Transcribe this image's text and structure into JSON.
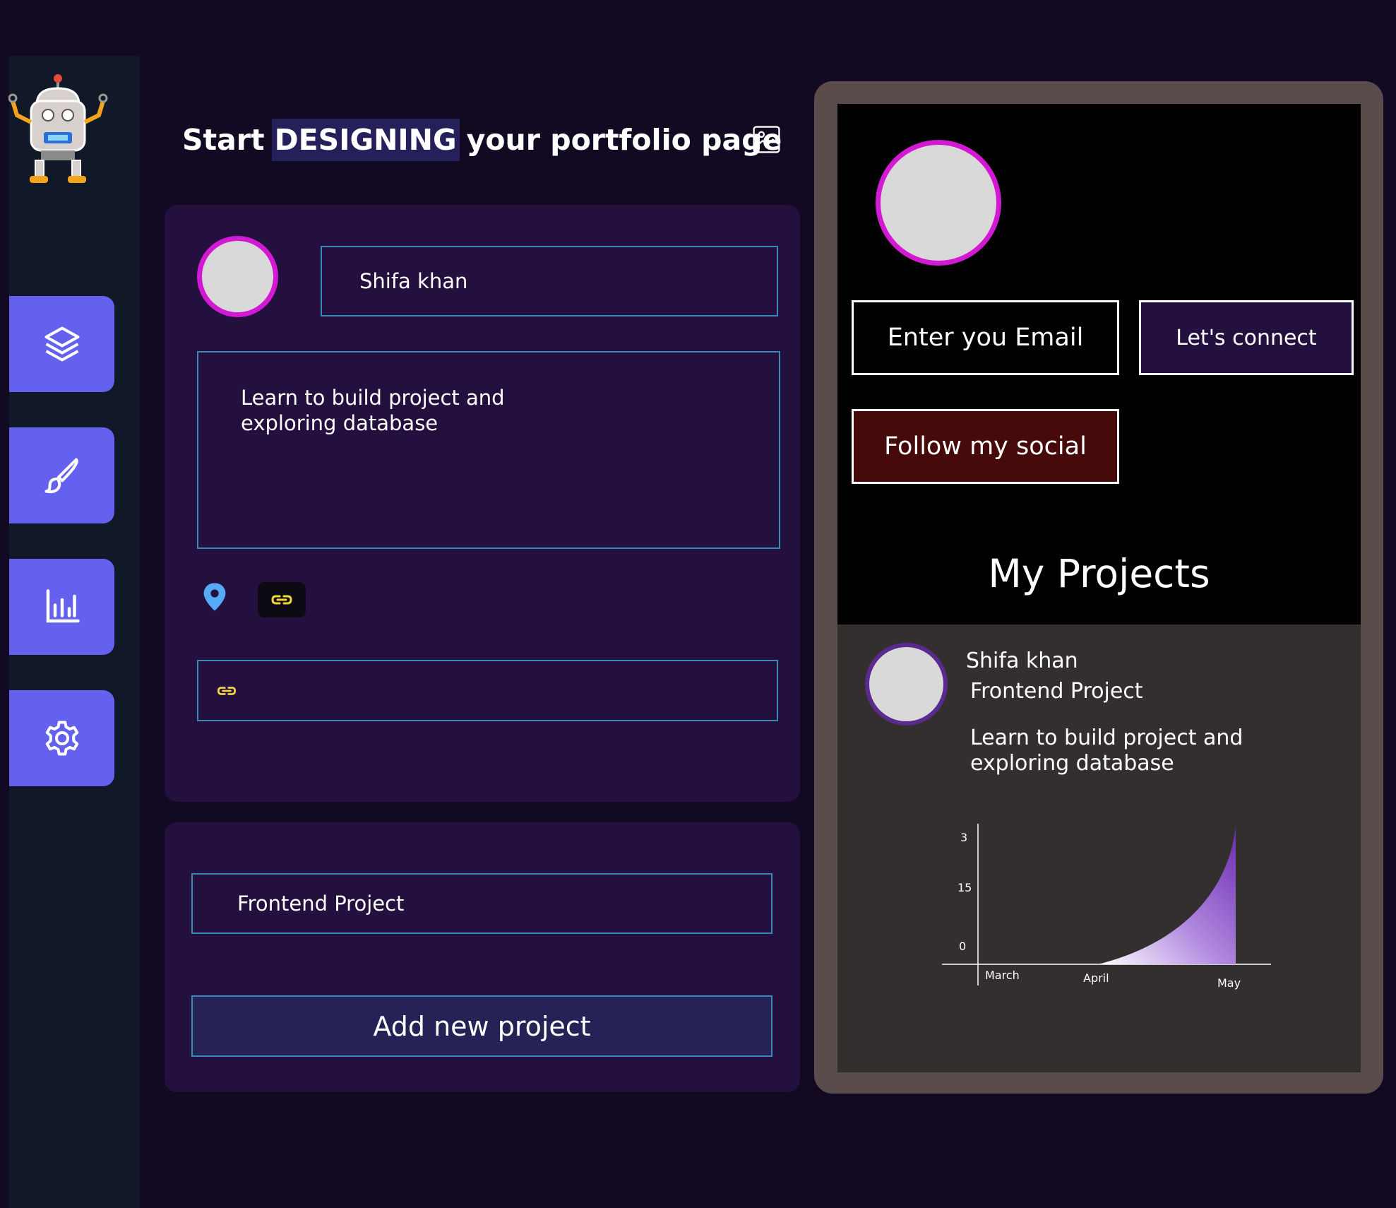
{
  "heading": {
    "prefix": "Start",
    "highlight": "DESIGNING",
    "suffix": "your portfolio page"
  },
  "sidebar": {
    "items": [
      {
        "icon": "layers-icon"
      },
      {
        "icon": "brush-icon"
      },
      {
        "icon": "chart-icon"
      },
      {
        "icon": "gear-icon"
      }
    ]
  },
  "editor": {
    "name_value": "Shifa khan",
    "bio_line1": "Learn  to build project and",
    "bio_line2": "exploring database",
    "link_value": ""
  },
  "project_editor": {
    "project_name_value": "Frontend Project",
    "add_button_label": "Add new project"
  },
  "preview": {
    "email_label": "Enter you Email",
    "connect_label": "Let's connect",
    "social_label": "Follow my social",
    "projects_title": "My Projects",
    "card": {
      "name": "Shifa khan",
      "project": "Frontend Project",
      "desc_line1": "Learn  to build project and",
      "desc_line2": "exploring database"
    }
  },
  "colors": {
    "accent": "#6361ee",
    "avatar_ring": "#d21ad4",
    "social_button": "#470a0a",
    "connect_button": "#24103f"
  },
  "chart_data": {
    "type": "area",
    "categories": [
      "March",
      "April",
      "May"
    ],
    "y_ticks": [
      "3",
      "15",
      "0"
    ],
    "series": [
      {
        "values": [
          0,
          0,
          3
        ]
      }
    ],
    "ylim": [
      0,
      3
    ],
    "grid": false
  }
}
